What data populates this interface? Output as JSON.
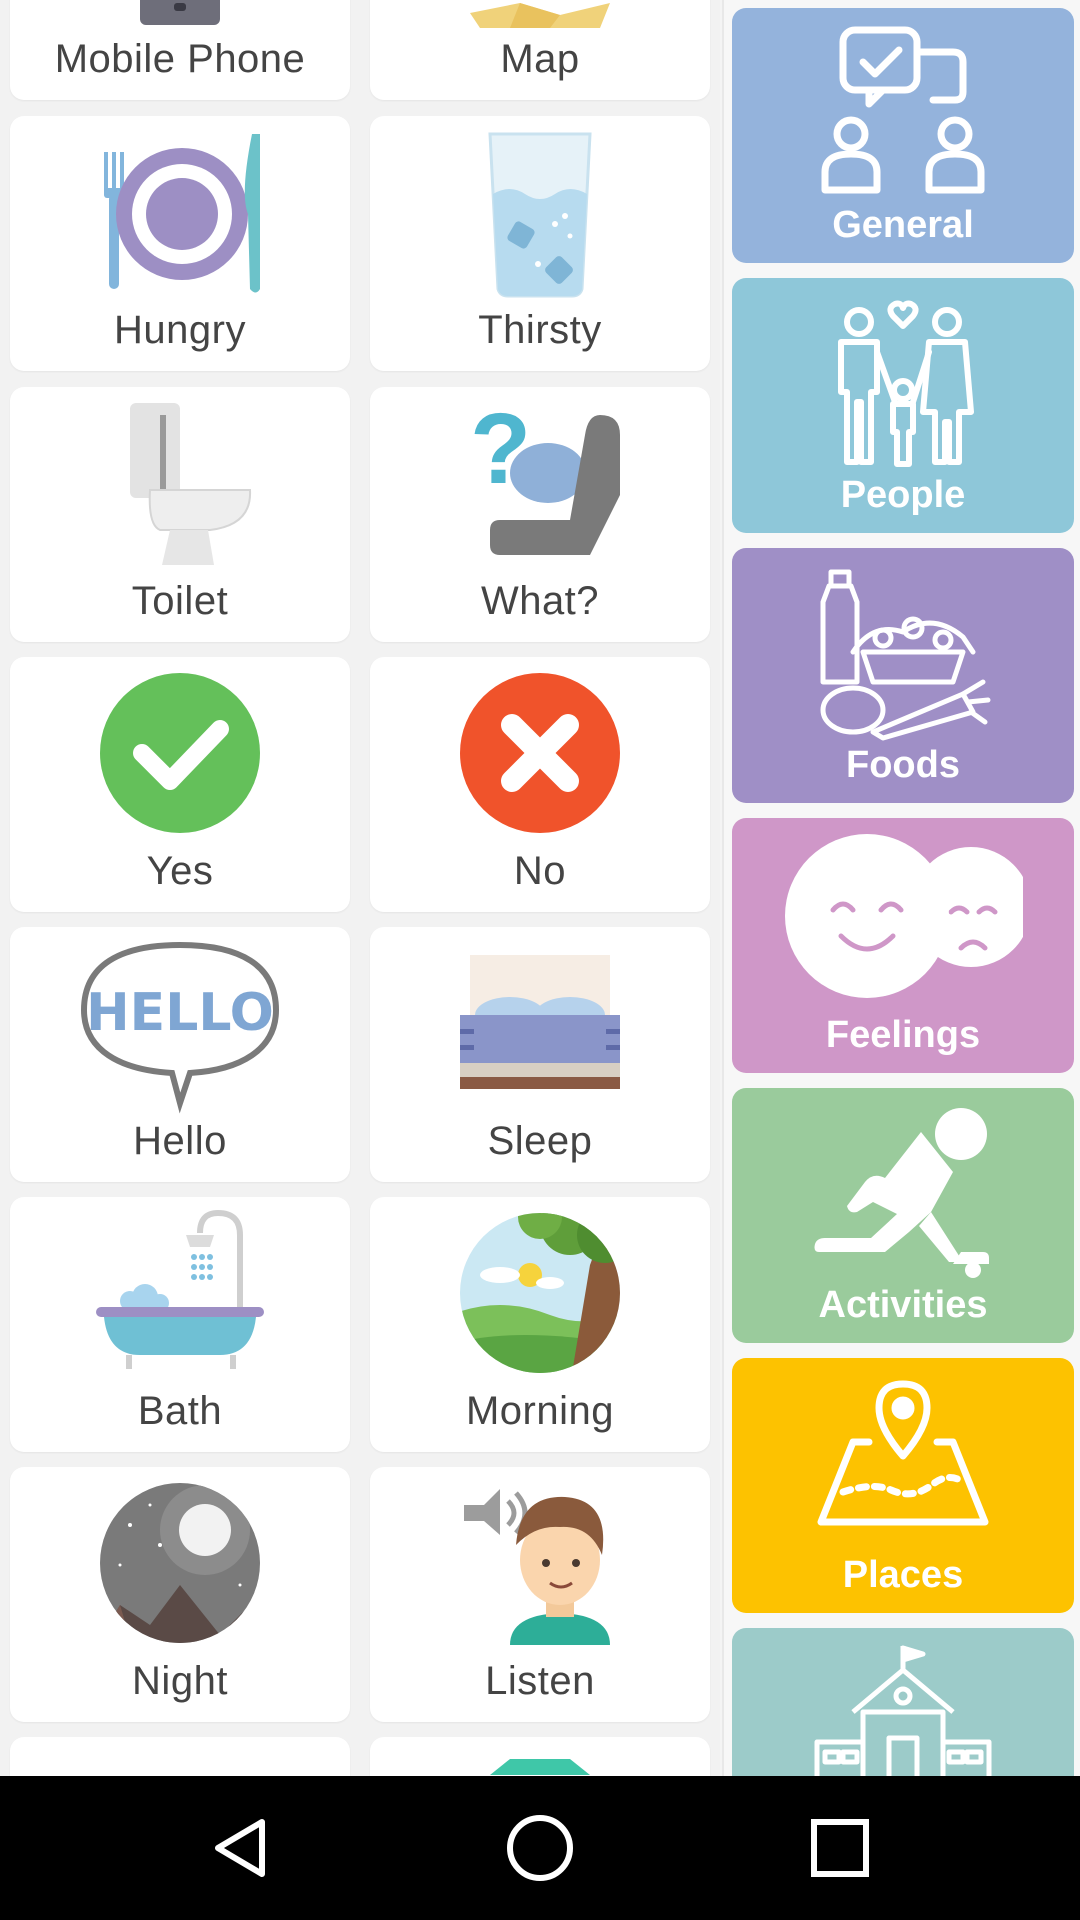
{
  "tiles": [
    {
      "label": "Mobile Phone"
    },
    {
      "label": "Map"
    },
    {
      "label": "Hungry"
    },
    {
      "label": "Thirsty"
    },
    {
      "label": "Toilet"
    },
    {
      "label": "What?"
    },
    {
      "label": "Yes"
    },
    {
      "label": "No"
    },
    {
      "label": "Hello"
    },
    {
      "label": "Sleep"
    },
    {
      "label": "Bath"
    },
    {
      "label": "Morning"
    },
    {
      "label": "Night"
    },
    {
      "label": "Listen"
    }
  ],
  "hello_art_text": "HELLO",
  "categories": [
    {
      "label": "General",
      "color": "#94b3dc"
    },
    {
      "label": "People",
      "color": "#8ec7d9"
    },
    {
      "label": "Foods",
      "color": "#9f8fc6"
    },
    {
      "label": "Feelings",
      "color": "#cf97c8"
    },
    {
      "label": "Activities",
      "color": "#9acb9c"
    },
    {
      "label": "Places",
      "color": "#fdc200"
    },
    {
      "label": "",
      "color": "#9ccbc9"
    }
  ],
  "navbar": {
    "back": "back-icon",
    "home": "home-icon",
    "recents": "recents-icon"
  }
}
